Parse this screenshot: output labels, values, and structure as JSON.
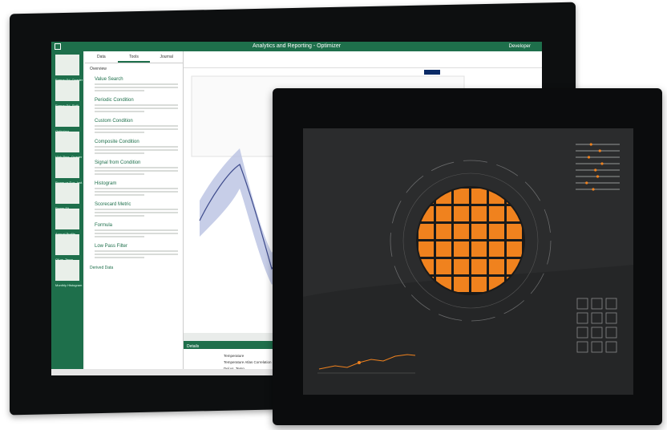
{
  "back_device": {
    "window_title": "Analytics and Reporting - Optimizer",
    "user_label": "Developer",
    "sidebar_thumbs": [
      "Energy Fd. Quarter",
      "Energy Fd. Shift",
      "Optimizer",
      "High Pres. Quarter",
      "Power vs Eos. Inst.",
      "Power Fit",
      "Annual Profile",
      "Oil vs. Temp",
      "Monthly Histogram"
    ],
    "side_tabs": [
      "Data",
      "Tools",
      "Journal"
    ],
    "tools_overview": "Overview",
    "tools": [
      {
        "name": "Value Search"
      },
      {
        "name": "Periodic Condition"
      },
      {
        "name": "Custom Condition"
      },
      {
        "name": "Composite Condition"
      },
      {
        "name": "Signal from Condition"
      },
      {
        "name": "Histogram"
      },
      {
        "name": "Scorecard Metric"
      },
      {
        "name": "Formula"
      },
      {
        "name": "Low Pass Filter"
      }
    ],
    "derived_data_label": "Derived Data",
    "details_label": "Details",
    "legend_rows": [
      "Temperature",
      "Temperature Atlas Correlation Searches",
      "Del vs. Temp"
    ]
  },
  "front_device": {
    "icon_grid": {
      "rows": 4,
      "cols": 3
    },
    "slider_levels": [
      0.35,
      0.55,
      0.3,
      0.6,
      0.45,
      0.5,
      0.25,
      0.4
    ]
  },
  "colors": {
    "accent_green": "#1e6f4b",
    "accent_orange": "#f0821e",
    "hmi_background": "#2b2c2d"
  }
}
